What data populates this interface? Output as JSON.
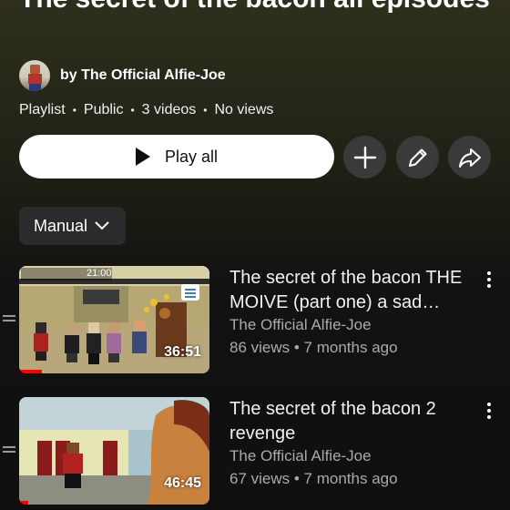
{
  "playlist": {
    "title": "The secret of the bacon all episodes",
    "owner": "by The Official Alfie-Joe",
    "meta": [
      "Playlist",
      "Public",
      "3 videos",
      "No views"
    ],
    "meta_sep": "•"
  },
  "actions": {
    "play_all": "Play all",
    "icons": [
      "plus-icon",
      "pencil-icon",
      "share-icon"
    ]
  },
  "sort": {
    "label": "Manual"
  },
  "videos": [
    {
      "title": "The secret of the bacon THE MOIVE (part one) a sad…",
      "channel": "The Official Alfie-Joe",
      "stats": "86 views • 7 months ago",
      "duration": "36:51",
      "overlay_time": "21:00",
      "watched_fraction": 0.12
    },
    {
      "title": "The secret of the bacon 2 revenge",
      "channel": "The Official Alfie-Joe",
      "stats": "67 views • 7 months ago",
      "duration": "46:45",
      "watched_fraction": 0.05
    }
  ],
  "colors": {
    "background": "#0f0f0f",
    "progress": "#ff0000",
    "secondary_text": "#aaaaaa",
    "button_bg": "#3a3a3a"
  }
}
